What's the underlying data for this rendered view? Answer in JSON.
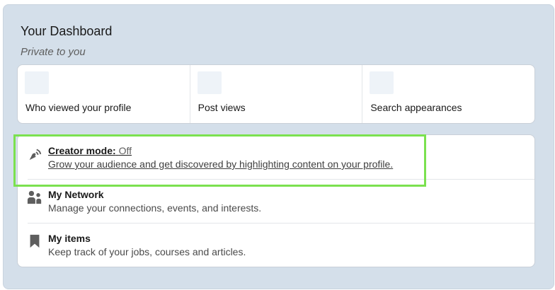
{
  "dashboard": {
    "title": "Your Dashboard",
    "subtitle": "Private to you"
  },
  "stats": [
    {
      "label": "Who viewed your profile"
    },
    {
      "label": "Post views"
    },
    {
      "label": "Search appearances"
    }
  ],
  "items": [
    {
      "title": "Creator mode:",
      "state": "Off",
      "description": "Grow your audience and get discovered by highlighting content on your profile.",
      "icon": "broadcast-icon"
    },
    {
      "title": "My Network",
      "description": "Manage your connections, events, and interests.",
      "icon": "people-icon"
    },
    {
      "title": "My items",
      "description": "Keep track of your jobs, courses and articles.",
      "icon": "bookmark-icon"
    }
  ],
  "colors": {
    "panel_background": "#d4dfea",
    "highlight_border": "#7be14f",
    "placeholder": "#eef3f8"
  }
}
